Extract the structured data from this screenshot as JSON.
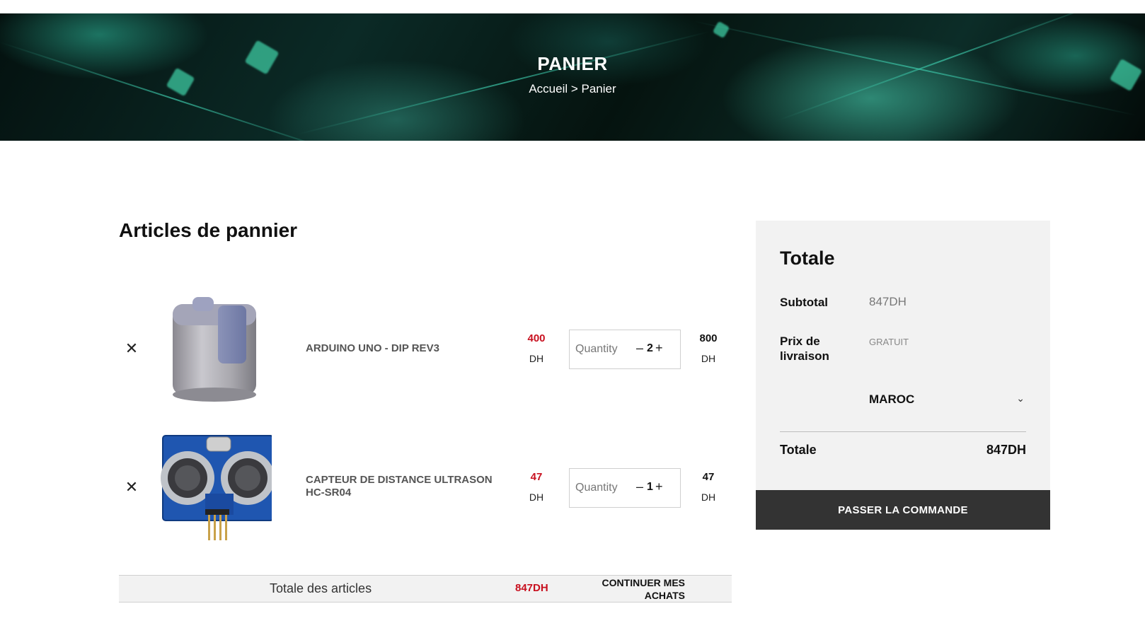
{
  "hero": {
    "title": "PANIER",
    "breadcrumb_home": "Accueil",
    "breadcrumb_sep": " > ",
    "breadcrumb_current": "Panier"
  },
  "cart": {
    "title": "Articles de pannier",
    "items": [
      {
        "name": "ARDUINO UNO - DIP REV3",
        "price": "400",
        "price_currency": "DH",
        "quantity_label": "Quantity",
        "quantity": "2",
        "total": "800",
        "total_currency": "DH",
        "image": "sensor-cylinder-image"
      },
      {
        "name": "CAPTEUR DE DISTANCE ULTRASON HC-SR04",
        "price": "47",
        "price_currency": "DH",
        "quantity_label": "Quantity",
        "quantity": "1",
        "total": "47",
        "total_currency": "DH",
        "image": "hc-sr04-module-image"
      }
    ],
    "footer": {
      "total_label": "Totale des articles",
      "total_value": "847DH",
      "continue_label": "CONTINUER MES ACHATS"
    }
  },
  "summary": {
    "title": "Totale",
    "subtotal_label": "Subtotal",
    "subtotal_value": "847DH",
    "shipping_label": "Prix de livraison",
    "shipping_value": "GRATUIT",
    "country": "MAROC",
    "total_label": "Totale",
    "total_value": "847DH",
    "checkout_label": "PASSER LA COMMANDE"
  },
  "colors": {
    "accent_red": "#c8101f",
    "checkout_bg": "#333333",
    "panel_bg": "#f2f2f2",
    "hero_glow": "#2fbea0"
  }
}
